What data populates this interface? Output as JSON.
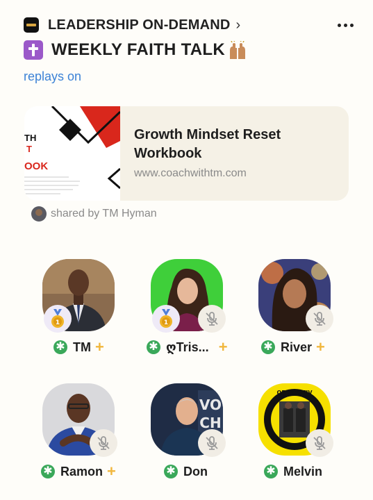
{
  "header": {
    "club_name": "LEADERSHIP ON-DEMAND",
    "chevron": "›",
    "more_icon": "more-dots-icon"
  },
  "room": {
    "title": "WEEKLY FAITH TALK",
    "title_icons": [
      "latin-cross-icon",
      "raised-hands-icon"
    ],
    "replays_label": "replays on"
  },
  "link_card": {
    "title": "Growth Mindset Reset Workbook",
    "url": "www.coachwithtm.com",
    "thumb_text_top": "TH",
    "thumb_text_mid": "T",
    "thumb_text_big": "OOK"
  },
  "shared": {
    "text": "shared by TM Hyman"
  },
  "speakers": [
    {
      "name": "TM",
      "moderator": true,
      "plus": "+",
      "medal": true,
      "muted": false
    },
    {
      "name": "ღTris...",
      "moderator": true,
      "plus": "+",
      "medal": true,
      "muted": true
    },
    {
      "name": "River",
      "moderator": true,
      "plus": "+",
      "medal": false,
      "muted": true
    },
    {
      "name": "Ramon",
      "moderator": true,
      "plus": "+",
      "medal": false,
      "muted": true
    },
    {
      "name": "Don",
      "moderator": true,
      "plus": "",
      "medal": false,
      "muted": true
    },
    {
      "name": "Melvin",
      "moderator": true,
      "plus": "",
      "medal": false,
      "muted": true
    }
  ],
  "moderator_symbol": "✱",
  "colors": {
    "background": "#fefdf9",
    "link_blue": "#3b82d6",
    "moderator_green": "#3aa85a",
    "plus_gold": "#f1b73d"
  }
}
